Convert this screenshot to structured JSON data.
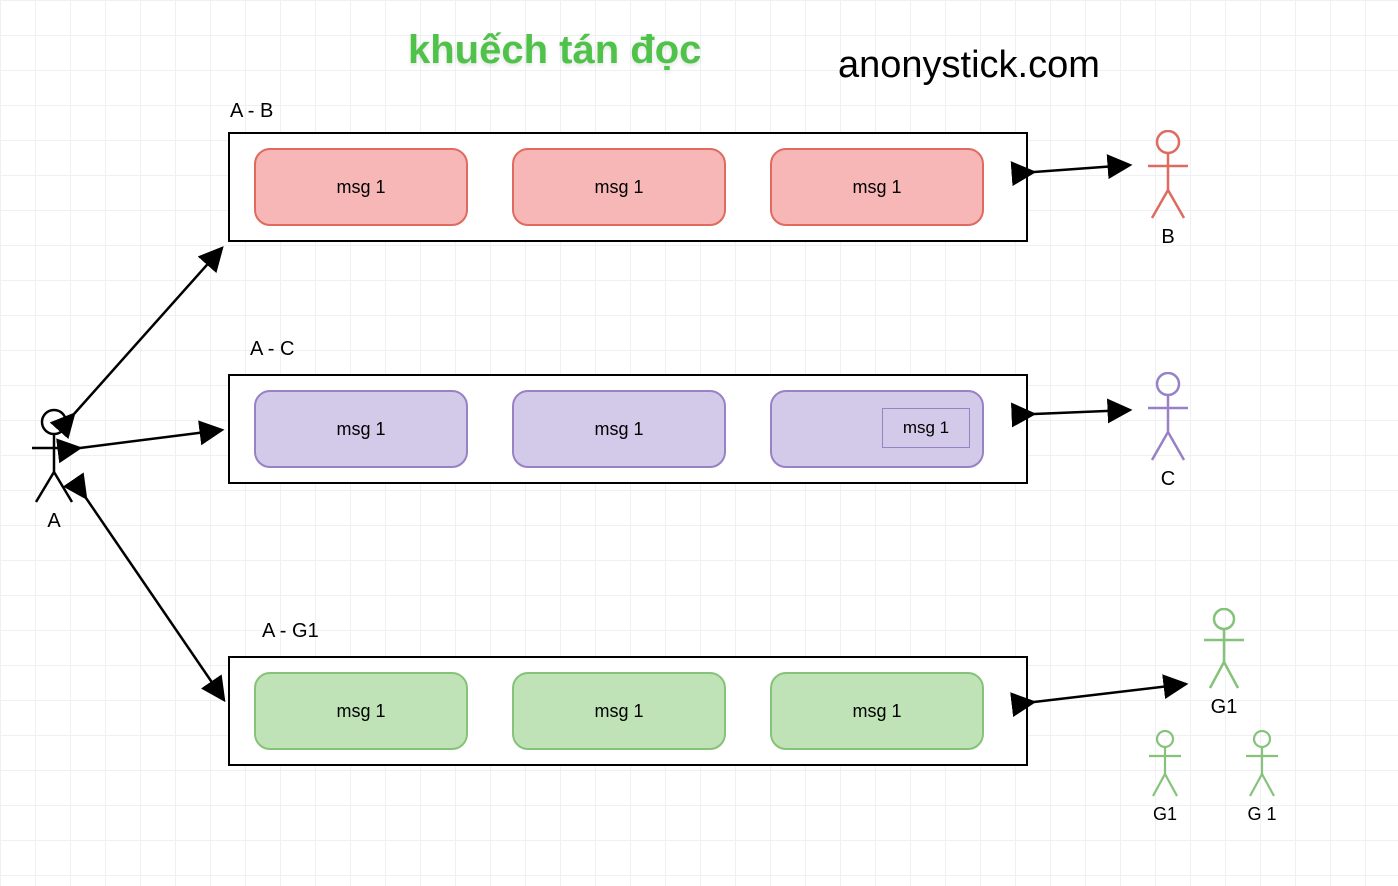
{
  "title": "khuếch tán đọc",
  "watermark": "anonystick.com",
  "actor_left": "A",
  "rows": [
    {
      "label": "A - B",
      "color": "pink",
      "msgs": [
        "msg 1",
        "msg 1",
        "msg 1"
      ],
      "right_actor": "B",
      "sub": null
    },
    {
      "label": "A - C",
      "color": "purple",
      "msgs": [
        "msg 1",
        "msg 1",
        "msg 1"
      ],
      "right_actor": "C",
      "sub": "msg 1"
    },
    {
      "label": "A - G1",
      "color": "green",
      "msgs": [
        "msg 1",
        "msg 1",
        "msg 1"
      ],
      "right_actor": "G1",
      "sub": null
    }
  ],
  "group_extra_actors": [
    "G1",
    "G 1"
  ]
}
